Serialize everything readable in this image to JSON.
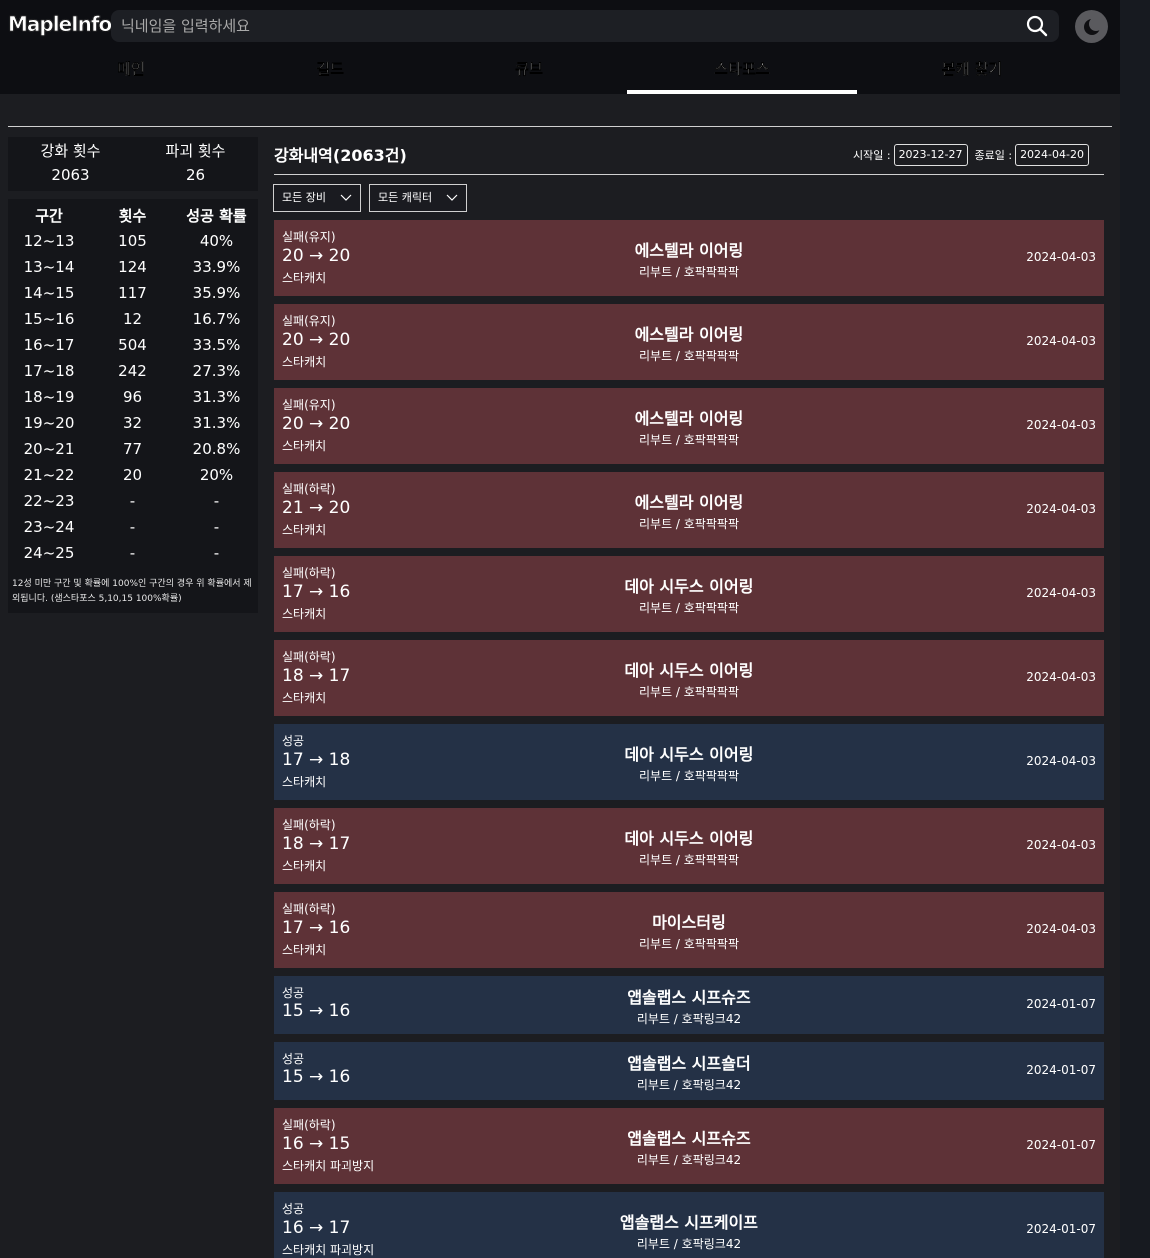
{
  "header": {
    "logo": "MapleInfo",
    "search_placeholder": "닉네임을 입력하세요",
    "nav": [
      {
        "label": "메인"
      },
      {
        "label": "길드"
      },
      {
        "label": "큐브"
      },
      {
        "label": "스타포스",
        "active": true
      },
      {
        "label": "본캐 찾기"
      }
    ]
  },
  "summary": {
    "enhance_label": "강화 횟수",
    "enhance_count": "2063",
    "destroy_label": "파괴 횟수",
    "destroy_count": "26"
  },
  "stats": {
    "headers": [
      "구간",
      "횟수",
      "성공 확률"
    ],
    "rows": [
      [
        "12~13",
        "105",
        "40%"
      ],
      [
        "13~14",
        "124",
        "33.9%"
      ],
      [
        "14~15",
        "117",
        "35.9%"
      ],
      [
        "15~16",
        "12",
        "16.7%"
      ],
      [
        "16~17",
        "504",
        "33.5%"
      ],
      [
        "17~18",
        "242",
        "27.3%"
      ],
      [
        "18~19",
        "96",
        "31.3%"
      ],
      [
        "19~20",
        "32",
        "31.3%"
      ],
      [
        "20~21",
        "77",
        "20.8%"
      ],
      [
        "21~22",
        "20",
        "20%"
      ],
      [
        "22~23",
        "-",
        "-"
      ],
      [
        "23~24",
        "-",
        "-"
      ],
      [
        "24~25",
        "-",
        "-"
      ]
    ],
    "note": "12성 미만 구간 및 확률에 100%인 구간의 경우 위 확률에서 제외됩니다. (샘스타포스 5,10,15 100%확률)"
  },
  "history": {
    "title": "강화내역(2063건)",
    "start_label": "시작일 :",
    "start_date": "2023-12-27",
    "end_label": "종료일 :",
    "end_date": "2024-04-20",
    "filter_all_types": "모든 장비",
    "filter_all_chars": "모든 캐릭터",
    "cards": [
      {
        "status": "fail",
        "result": "실패(유지)",
        "star": "20 → 20",
        "tags": "스타캐치",
        "item": "에스텔라 이어링",
        "character": "리부트 / 호팍팍팍팍",
        "date": "2024-04-03"
      },
      {
        "status": "fail",
        "result": "실패(유지)",
        "star": "20 → 20",
        "tags": "스타캐치",
        "item": "에스텔라 이어링",
        "character": "리부트 / 호팍팍팍팍",
        "date": "2024-04-03"
      },
      {
        "status": "fail",
        "result": "실패(유지)",
        "star": "20 → 20",
        "tags": "스타캐치",
        "item": "에스텔라 이어링",
        "character": "리부트 / 호팍팍팍팍",
        "date": "2024-04-03"
      },
      {
        "status": "fail",
        "result": "실패(하락)",
        "star": "21 → 20",
        "tags": "스타캐치",
        "item": "에스텔라 이어링",
        "character": "리부트 / 호팍팍팍팍",
        "date": "2024-04-03"
      },
      {
        "status": "fail",
        "result": "실패(하락)",
        "star": "17 → 16",
        "tags": "스타캐치",
        "item": "데아 시두스 이어링",
        "character": "리부트 / 호팍팍팍팍",
        "date": "2024-04-03"
      },
      {
        "status": "fail",
        "result": "실패(하락)",
        "star": "18 → 17",
        "tags": "스타캐치",
        "item": "데아 시두스 이어링",
        "character": "리부트 / 호팍팍팍팍",
        "date": "2024-04-03"
      },
      {
        "status": "success",
        "result": "성공",
        "star": "17 → 18",
        "tags": "스타캐치",
        "item": "데아 시두스 이어링",
        "character": "리부트 / 호팍팍팍팍",
        "date": "2024-04-03"
      },
      {
        "status": "fail",
        "result": "실패(하락)",
        "star": "18 → 17",
        "tags": "스타캐치",
        "item": "데아 시두스 이어링",
        "character": "리부트 / 호팍팍팍팍",
        "date": "2024-04-03"
      },
      {
        "status": "fail",
        "result": "실패(하락)",
        "star": "17 → 16",
        "tags": "스타캐치",
        "item": "마이스터링",
        "character": "리부트 / 호팍팍팍팍",
        "date": "2024-04-03"
      },
      {
        "status": "success",
        "result": "성공",
        "star": "15 → 16",
        "tags": "",
        "item": "앱솔랩스 시프슈즈",
        "character": "리부트 / 호팍링크42",
        "date": "2024-01-07"
      },
      {
        "status": "success",
        "result": "성공",
        "star": "15 → 16",
        "tags": "",
        "item": "앱솔랩스 시프숄더",
        "character": "리부트 / 호팍링크42",
        "date": "2024-01-07"
      },
      {
        "status": "fail",
        "result": "실패(하락)",
        "star": "16 → 15",
        "tags": "스타캐치  파괴방지",
        "item": "앱솔랩스 시프슈즈",
        "character": "리부트 / 호팍링크42",
        "date": "2024-01-07"
      },
      {
        "status": "success",
        "result": "성공",
        "star": "16 → 17",
        "tags": "스타캐치  파괴방지",
        "item": "앱솔랩스 시프케이프",
        "character": "리부트 / 호팍링크42",
        "date": "2024-01-07"
      }
    ]
  }
}
